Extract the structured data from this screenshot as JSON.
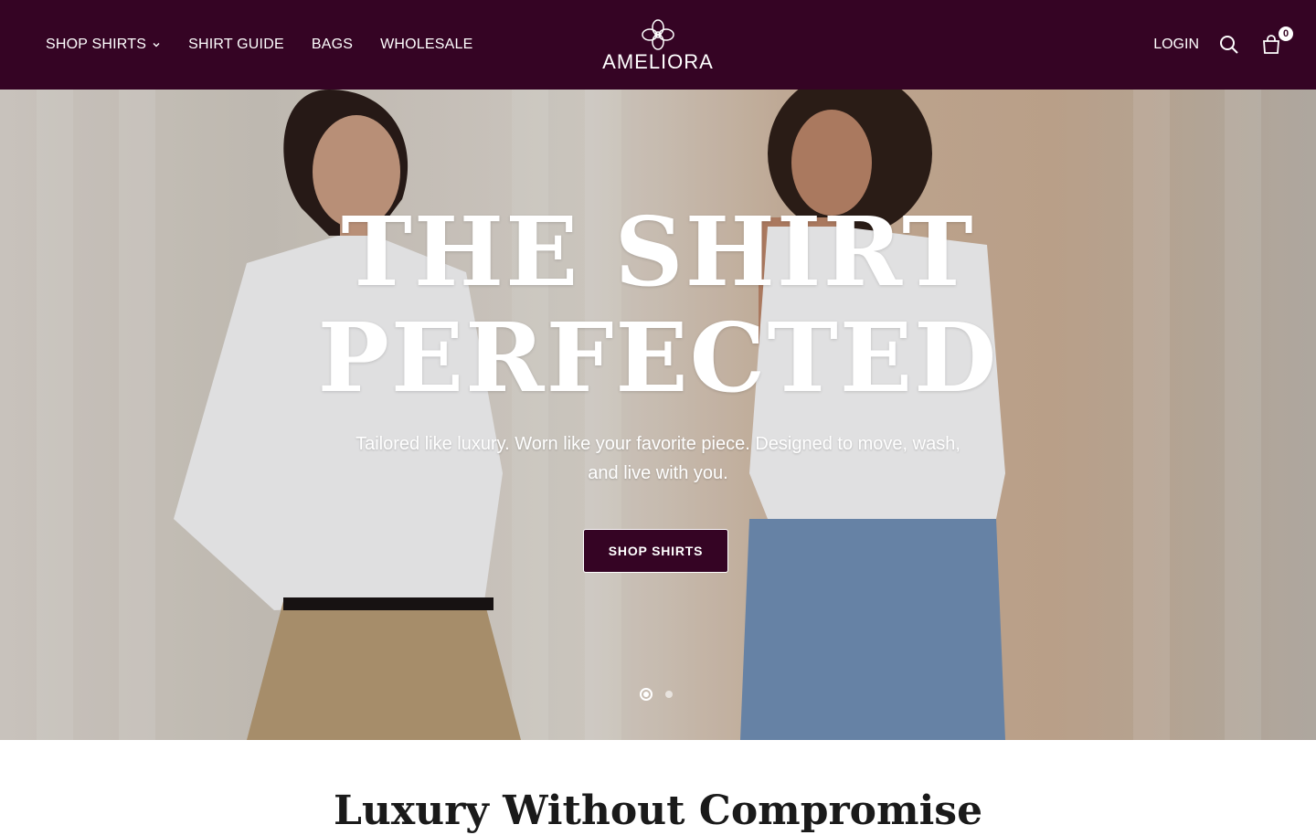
{
  "header": {
    "nav": [
      {
        "label": "SHOP SHIRTS",
        "has_dropdown": true
      },
      {
        "label": "SHIRT GUIDE"
      },
      {
        "label": "BAGS"
      },
      {
        "label": "WHOLESALE"
      }
    ],
    "logo_text": "AMELIORA",
    "login_label": "LOGIN",
    "cart_count": "0",
    "icons": [
      "search-icon",
      "cart-icon",
      "chevron-down-icon",
      "logo-flower-icon"
    ],
    "bg_color": "#350424"
  },
  "hero": {
    "title_line1": "THE SHIRT",
    "title_line2": "PERFECTED",
    "subtitle": "Tailored like luxury. Worn like your favorite piece. Designed to move, wash, and live with you.",
    "cta_label": "SHOP SHIRTS",
    "slides": 2,
    "active_slide": 1
  },
  "section": {
    "title": "Luxury Without Compromise"
  },
  "colors": {
    "brand": "#350424",
    "text_light": "#ffffff"
  }
}
